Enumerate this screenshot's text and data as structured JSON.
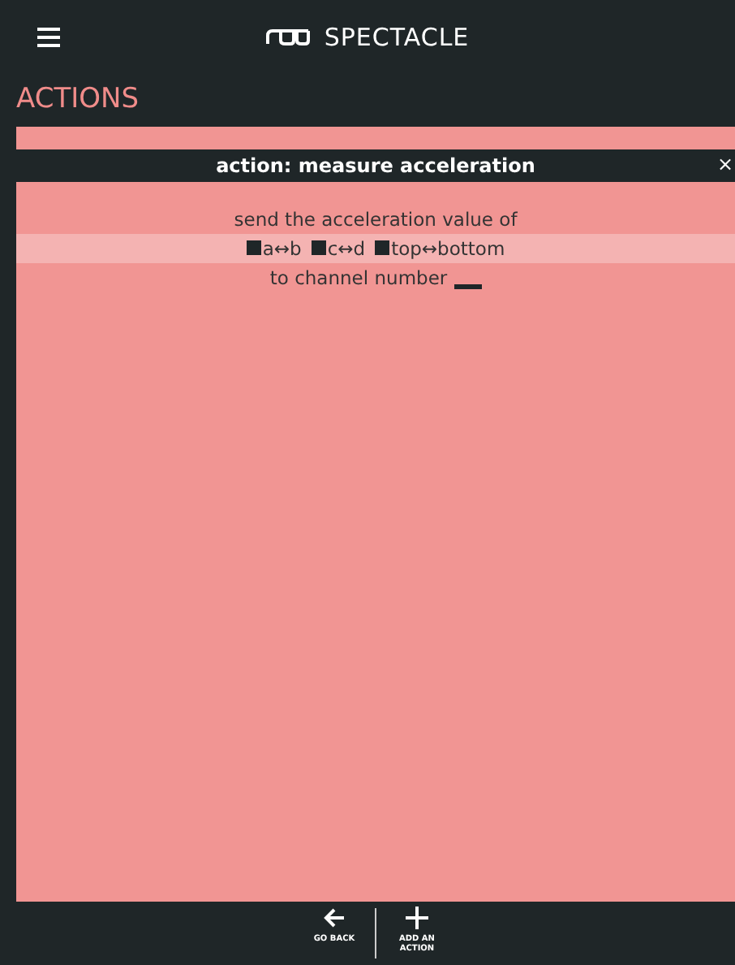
{
  "header": {
    "title": "SPECTACLE"
  },
  "section_title": "ACTIONS",
  "action": {
    "title": "action: measure acceleration",
    "close": "×",
    "intro": "send the acceleration value of",
    "options": [
      {
        "label": "a↔b",
        "checked": true
      },
      {
        "label": "c↔d",
        "checked": true
      },
      {
        "label": "top↔bottom",
        "checked": true
      }
    ],
    "channel_label": "to channel number"
  },
  "footer": {
    "buttons": [
      {
        "kind": "back",
        "label": "GO BACK"
      },
      {
        "kind": "add",
        "label": "ADD AN ACTION"
      }
    ]
  }
}
